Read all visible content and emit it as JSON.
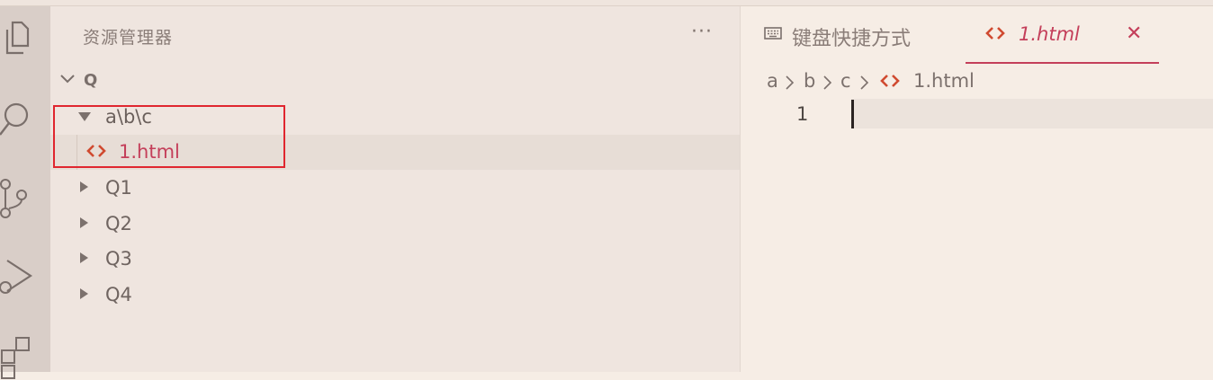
{
  "explorer": {
    "title": "资源管理器",
    "more": "···",
    "root": "Q",
    "folder_compact": "a\\b\\c",
    "file": "1.html",
    "folders": [
      "Q1",
      "Q2",
      "Q3",
      "Q4"
    ]
  },
  "editor": {
    "tabs": [
      {
        "label": "键盘快捷方式",
        "icon": "keyboard-icon"
      },
      {
        "label": "1.html",
        "icon": "html-file-icon",
        "close": "✕"
      }
    ],
    "breadcrumbs": [
      "a",
      "b",
      "c",
      "1.html"
    ],
    "line_number": "1"
  },
  "colors": {
    "accent": "#c43f5a",
    "html_icon": "#d04a30",
    "highlight_box": "#e0262f",
    "activity_bar": "#d9cec8",
    "sidebar_bg": "#efe5df",
    "editor_bg": "#f6ede5"
  },
  "icons": {
    "activity": [
      "files-icon",
      "search-icon",
      "source-control-icon",
      "run-debug-icon",
      "extensions-icon"
    ]
  }
}
